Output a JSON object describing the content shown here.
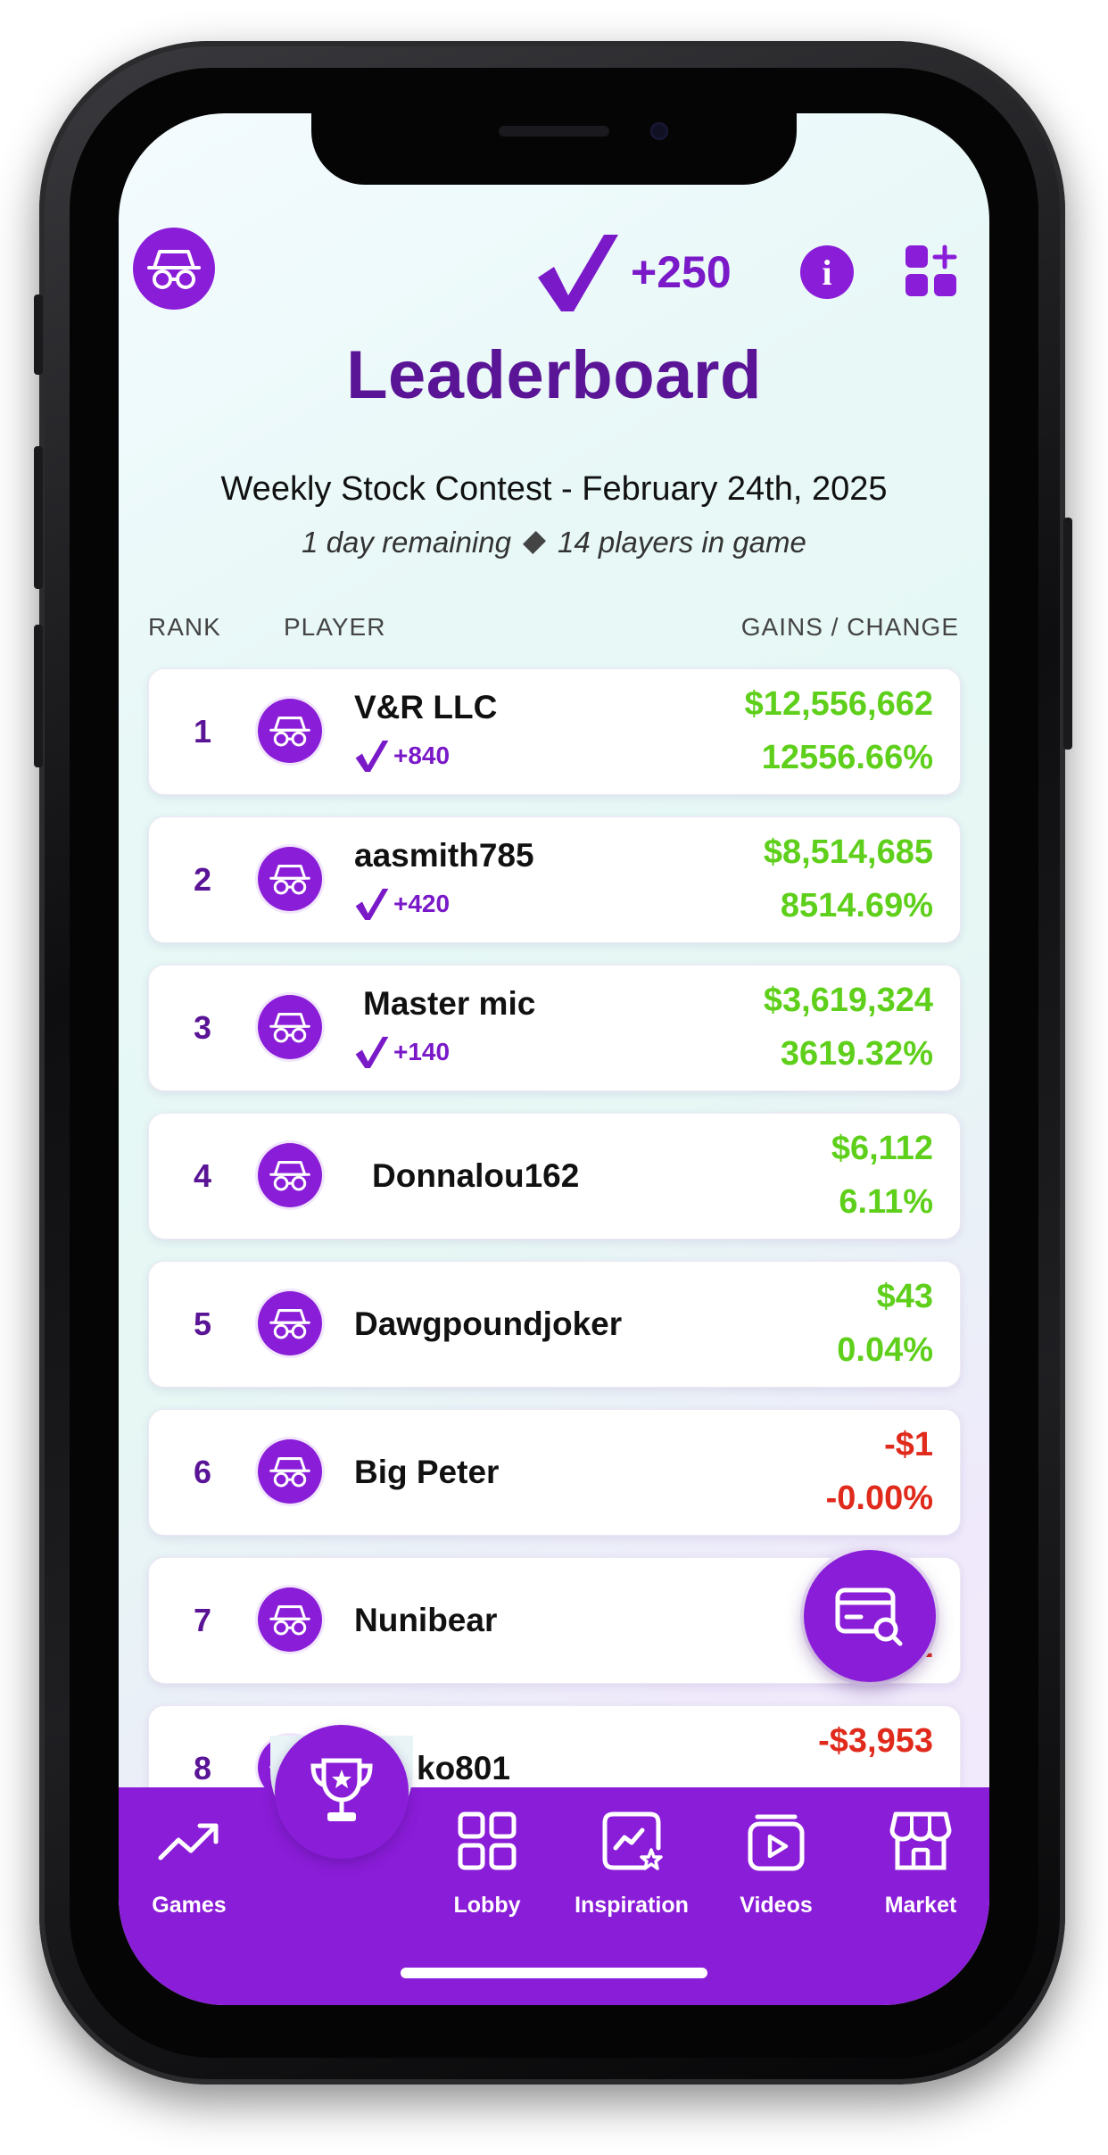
{
  "header": {
    "points_value": "+250",
    "info_label": "i"
  },
  "page_title": "Leaderboard",
  "contest": {
    "title": "Weekly Stock Contest - February 24th, 2025",
    "time_remaining": "1 day remaining",
    "players_count": "14 players in game"
  },
  "columns": {
    "rank": "RANK",
    "player": "PLAYER",
    "gains": "GAINS / CHANGE"
  },
  "leaderboard": [
    {
      "rank": "1",
      "name": "V&R LLC",
      "points": "+840",
      "gain": "$12,556,662",
      "change": "12556.66%",
      "positive": true
    },
    {
      "rank": "2",
      "name": "aasmith785",
      "points": "+420",
      "gain": "$8,514,685",
      "change": "8514.69%",
      "positive": true
    },
    {
      "rank": "3",
      "name": "Master mic",
      "points": "+140",
      "gain": "$3,619,324",
      "change": "3619.32%",
      "positive": true
    },
    {
      "rank": "4",
      "name": "Donnalou162",
      "points": "",
      "gain": "$6,112",
      "change": "6.11%",
      "positive": true
    },
    {
      "rank": "5",
      "name": "Dawgpoundjoker",
      "points": "",
      "gain": "$43",
      "change": "0.04%",
      "positive": true
    },
    {
      "rank": "6",
      "name": "Big Peter",
      "points": "",
      "gain": "-$1",
      "change": "-0.00%",
      "positive": false
    },
    {
      "rank": "7",
      "name": "Nunibear",
      "points": "",
      "gain": "-$",
      "change": "-2",
      "positive": false
    },
    {
      "rank": "8",
      "name": "ko801",
      "points": "",
      "gain": "-$3,953",
      "change": "",
      "positive": false
    }
  ],
  "nav": {
    "games": "Games",
    "lobby": "Lobby",
    "inspiration": "Inspiration",
    "videos": "Videos",
    "market": "Market"
  },
  "colors": {
    "brand_purple": "#8a1dd8",
    "title_purple": "#5a1496",
    "gain_green": "#5ecf1a",
    "loss_red": "#e02a1c"
  },
  "icons": [
    "incognito-icon",
    "check-points-icon",
    "info-icon",
    "apps-add-icon",
    "card-search-icon",
    "trend-up-icon",
    "trophy-icon",
    "grid-icon",
    "star-chart-icon",
    "video-play-icon",
    "storefront-icon"
  ]
}
